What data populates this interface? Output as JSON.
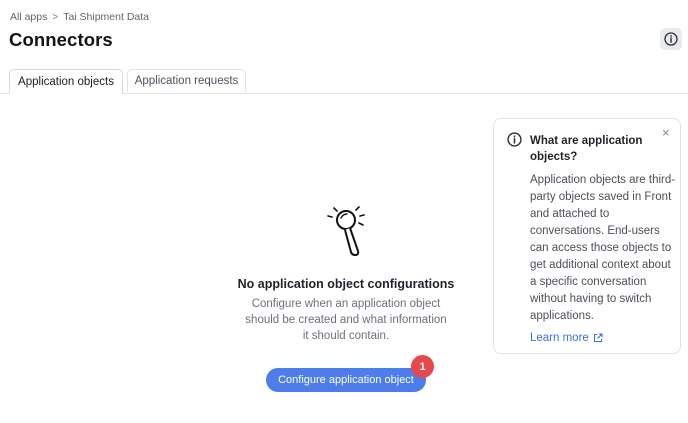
{
  "breadcrumb": {
    "root": "All apps",
    "separator": ">",
    "current": "Tai Shipment Data"
  },
  "page": {
    "title": "Connectors"
  },
  "tabs": [
    {
      "label": "Application objects",
      "active": true
    },
    {
      "label": "Application requests",
      "active": false
    }
  ],
  "empty_state": {
    "illustration": "magnifying-glass-icon",
    "title": "No application object configurations",
    "description": "Configure when an application object should be created and what information it should contain.",
    "button_label": "Configure application object",
    "step_badge": "1"
  },
  "info_card": {
    "icon": "info-icon",
    "title": "What are application objects?",
    "body": "Application objects are third-party objects saved in Front and attached to conversations. End-users can access those objects to get additional context about a specific conversation without having to switch applications.",
    "link_label": "Learn more",
    "close_symbol": "×"
  },
  "colors": {
    "primary": "#4c7de8",
    "badge": "#e5484d",
    "link": "#3f6fd8"
  }
}
